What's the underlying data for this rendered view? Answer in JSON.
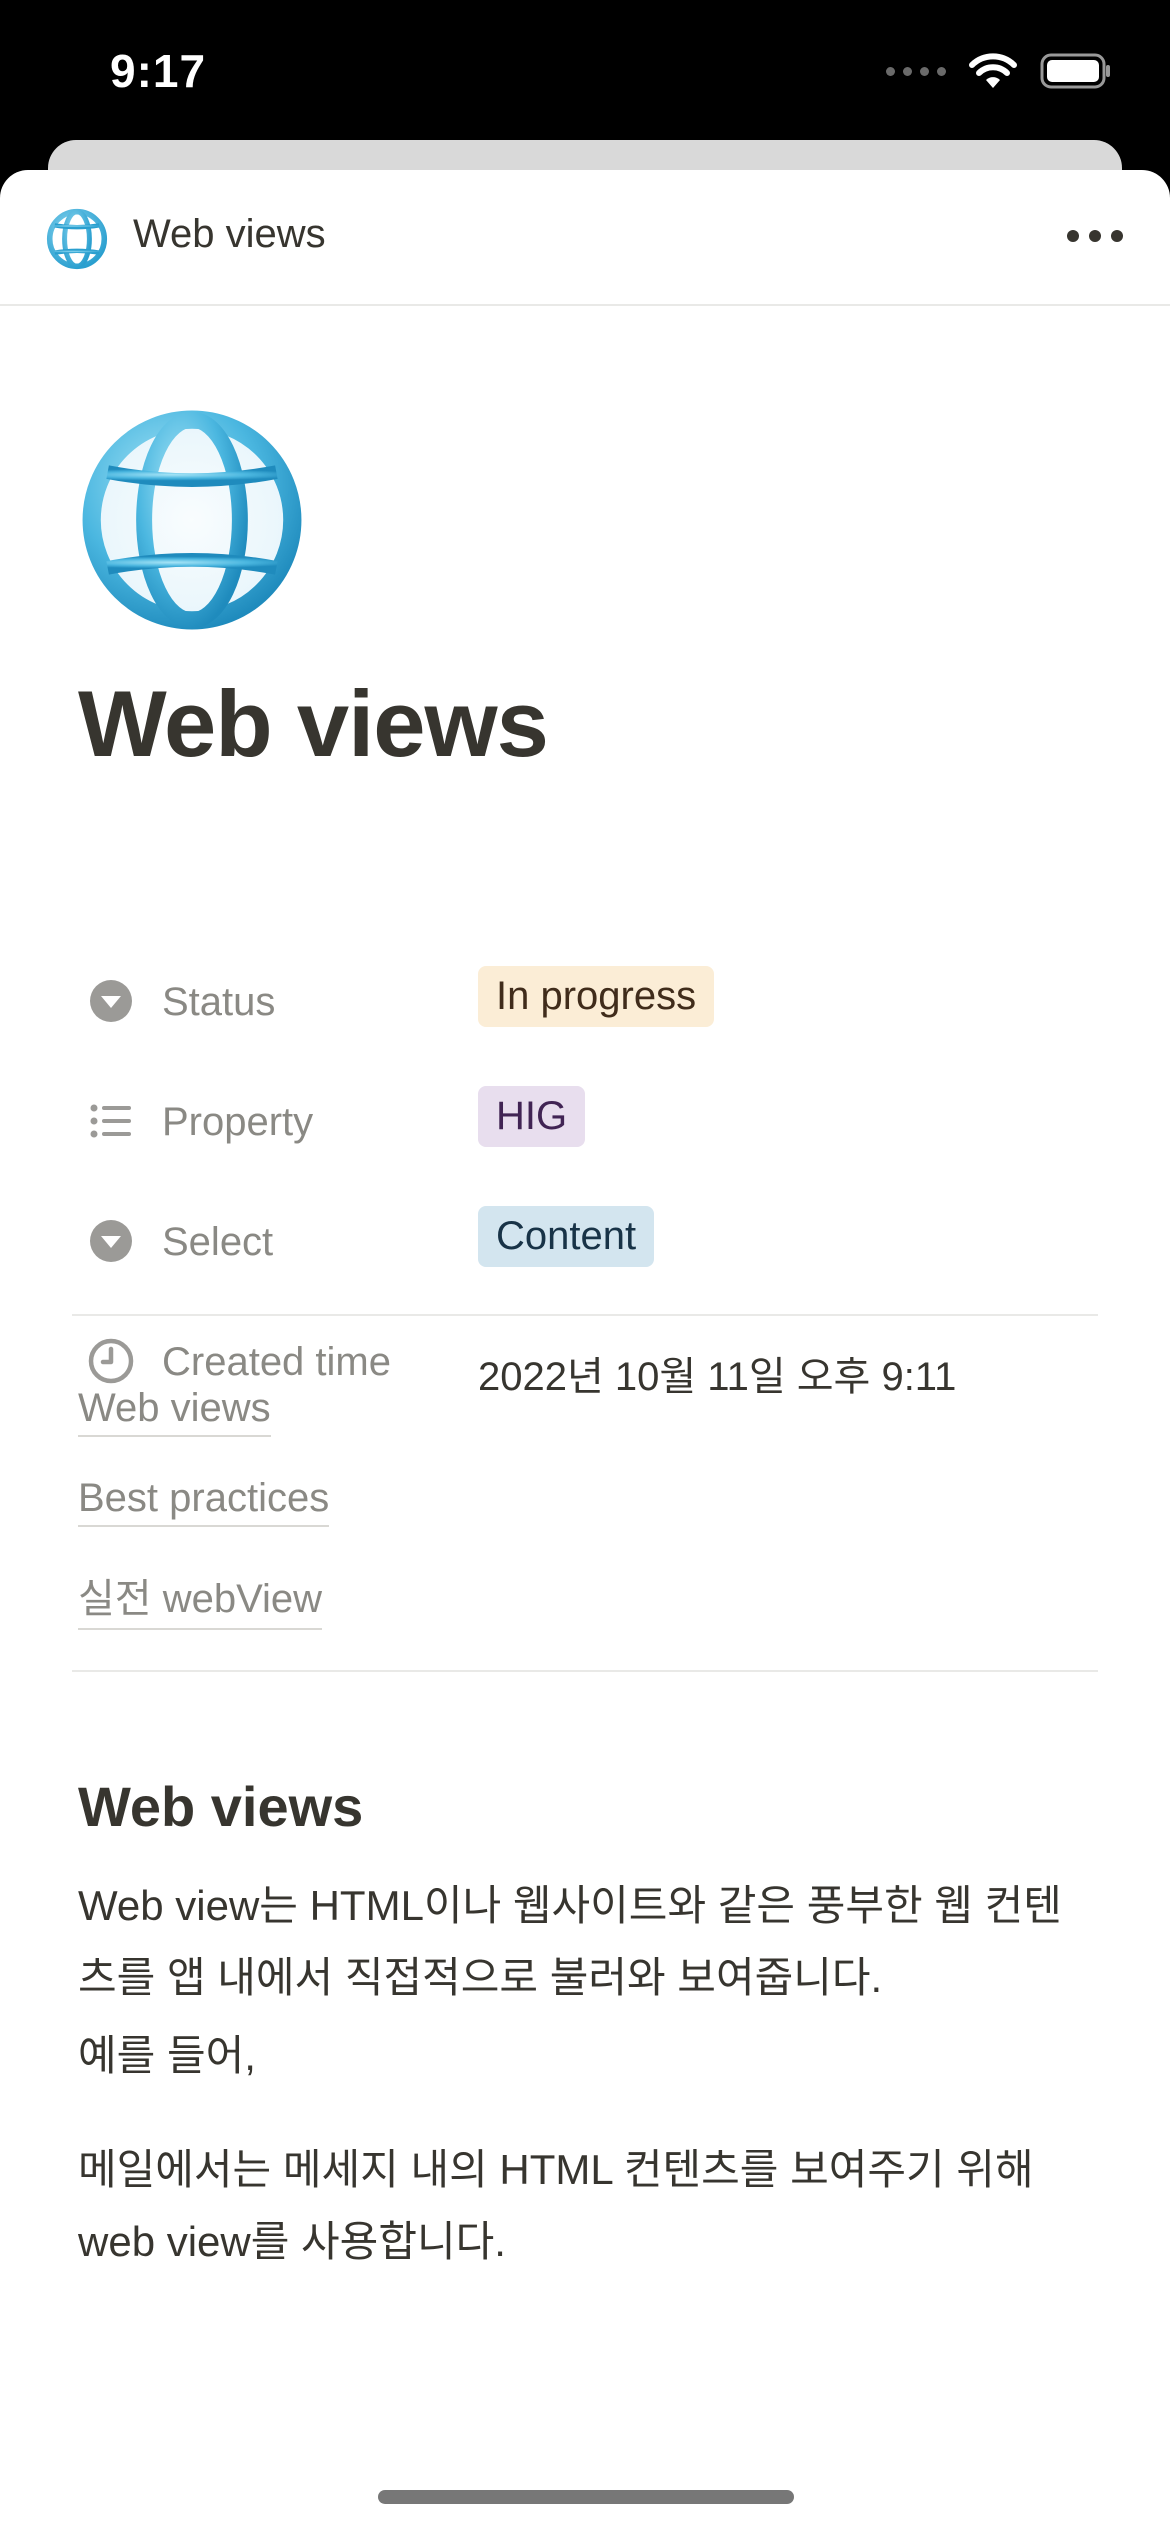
{
  "status_bar": {
    "time": "9:17"
  },
  "topbar": {
    "title": "Web views",
    "icon": "globe-icon",
    "more": "more-icon"
  },
  "page": {
    "icon": "globe-icon",
    "title": "Web views",
    "properties": [
      {
        "name": "Status",
        "icon": "select-icon",
        "value": "In progress",
        "tag_color": "#fbedd6"
      },
      {
        "name": "Property",
        "icon": "list-icon",
        "value": "HIG",
        "tag_color": "#e8deee"
      },
      {
        "name": "Select",
        "icon": "select-icon",
        "value": "Content",
        "tag_color": "#d3e5ef"
      },
      {
        "name": "Created time",
        "icon": "clock-icon",
        "value": "2022년 10월 11일 오후 9:11"
      }
    ],
    "links": [
      "Web views",
      "Best practices",
      "실전 webView"
    ],
    "section": {
      "heading": "Web views",
      "paragraphs": [
        "Web view는 HTML이나 웹사이트와 같은 풍부한 웹 컨텐츠를 앱 내에서 직접적으로 불러와 보여줍니다.",
        "예를 들어,",
        "메일에서는 메세지 내의 HTML 컨텐츠를 보여주기 위해 web view를 사용합니다."
      ]
    }
  },
  "colors": {
    "text": "#37352f",
    "muted": "#8a8984",
    "divider": "#e9e9e7"
  }
}
